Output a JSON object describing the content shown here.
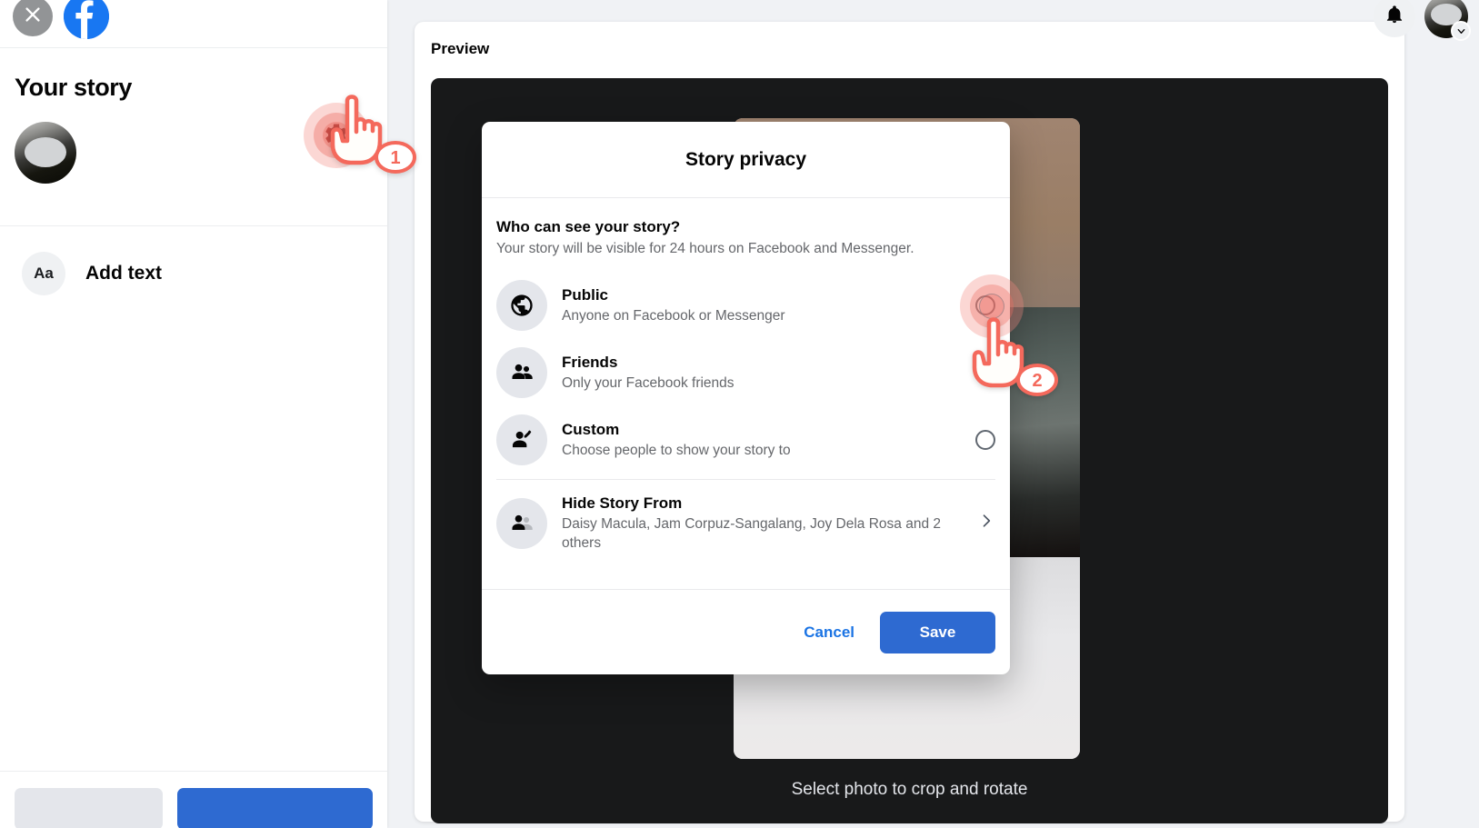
{
  "left_panel": {
    "close_icon": "close-icon",
    "brand_icon": "facebook-logo-icon",
    "title": "Your story",
    "avatar_name": "user-avatar",
    "gear_icon": "gear-icon",
    "add_text": {
      "icon_label": "Aa",
      "label": "Add text"
    }
  },
  "top_right": {
    "bell_icon": "bell-icon",
    "avatar_name": "account-avatar",
    "chevron_icon": "chevron-down-icon"
  },
  "main": {
    "preview_label": "Preview",
    "stage_caption": "Select photo to crop and rotate"
  },
  "dialog": {
    "title": "Story privacy",
    "question": "Who can see your story?",
    "description": "Your story will be visible for 24 hours on Facebook and Messenger.",
    "options": [
      {
        "icon": "globe-icon",
        "title": "Public",
        "desc": "Anyone on Facebook or Messenger",
        "selected": false
      },
      {
        "icon": "friends-icon",
        "title": "Friends",
        "desc": "Only your Facebook friends",
        "selected": true
      },
      {
        "icon": "custom-person-edit-icon",
        "title": "Custom",
        "desc": "Choose people to show your story to",
        "selected": false
      }
    ],
    "hide_story": {
      "icon": "person-hidden-icon",
      "title": "Hide Story From",
      "desc": "Daisy Macula, Jam Corpuz-Sangalang, Joy Dela Rosa and 2 others",
      "chevron": "chevron-right-icon"
    },
    "cancel_label": "Cancel",
    "save_label": "Save"
  },
  "annotations": {
    "step1": "1",
    "step2": "2"
  },
  "colors": {
    "accent_blue": "#1877f2",
    "save_blue": "#2e6ad1",
    "link_blue": "#1b74e4",
    "annotation_red": "#f4695c",
    "stage_dark": "#18191a",
    "muted_text": "#65676b"
  }
}
